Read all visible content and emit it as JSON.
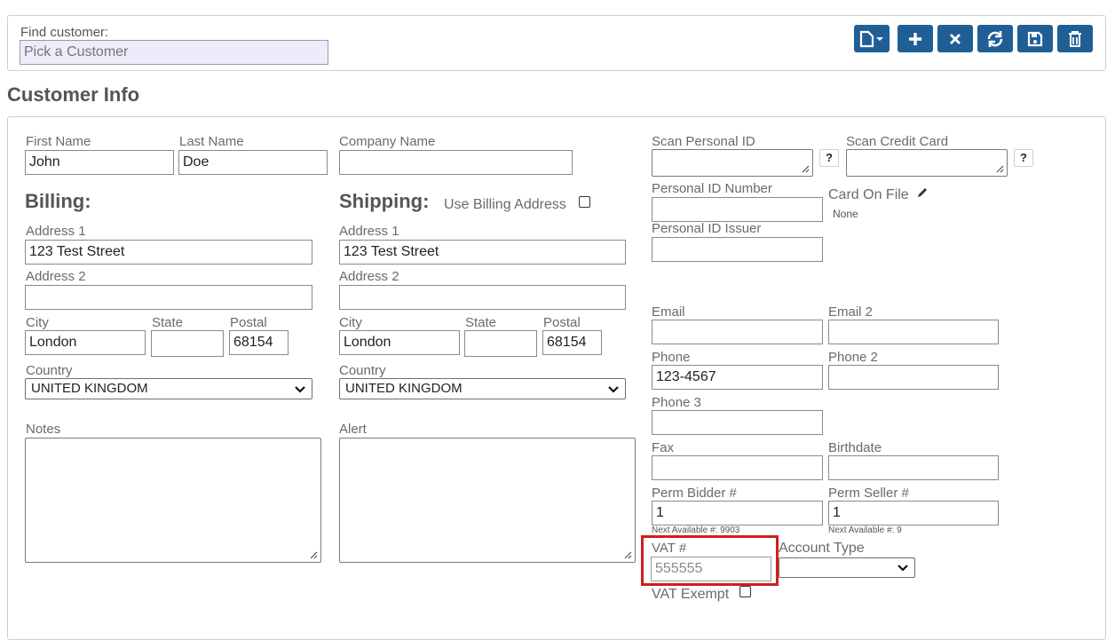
{
  "header": {
    "find_label": "Find customer:",
    "find_placeholder": "Pick a Customer"
  },
  "toolbar": {
    "buttons": [
      "new-document-menu",
      "add",
      "close",
      "refresh",
      "save",
      "delete"
    ]
  },
  "section_title": "Customer Info",
  "name": {
    "first_label": "First Name",
    "first_value": "John",
    "last_label": "Last Name",
    "last_value": "Doe",
    "company_label": "Company Name",
    "company_value": ""
  },
  "billing": {
    "heading": "Billing:",
    "address1_label": "Address 1",
    "address1_value": "123 Test Street",
    "address2_label": "Address 2",
    "address2_value": "",
    "city_label": "City",
    "city_value": "London",
    "state_label": "State",
    "state_value": "",
    "postal_label": "Postal",
    "postal_value": "68154",
    "country_label": "Country",
    "country_value": "UNITED KINGDOM"
  },
  "shipping": {
    "heading": "Shipping:",
    "use_billing_label": "Use Billing Address",
    "address1_label": "Address 1",
    "address1_value": "123 Test Street",
    "address2_label": "Address 2",
    "address2_value": "",
    "city_label": "City",
    "city_value": "London",
    "state_label": "State",
    "state_value": "",
    "postal_label": "Postal",
    "postal_value": "68154",
    "country_label": "Country",
    "country_value": "UNITED KINGDOM"
  },
  "notes_label": "Notes",
  "alert_label": "Alert",
  "scan": {
    "personal_id_label": "Scan Personal ID",
    "credit_card_label": "Scan Credit Card",
    "help_glyph": "?"
  },
  "personal_id_number_label": "Personal ID Number",
  "personal_id_issuer_label": "Personal ID Issuer",
  "card_on_file": {
    "label": "Card On File",
    "value": "None"
  },
  "contact": {
    "email_label": "Email",
    "email_value": "",
    "email2_label": "Email 2",
    "email2_value": "",
    "phone_label": "Phone",
    "phone_value": "123-4567",
    "phone2_label": "Phone 2",
    "phone2_value": "",
    "phone3_label": "Phone 3",
    "phone3_value": "",
    "fax_label": "Fax",
    "fax_value": "",
    "birthdate_label": "Birthdate",
    "birthdate_value": ""
  },
  "perm": {
    "bidder_label": "Perm Bidder #",
    "bidder_value": "1",
    "bidder_next": "Next Available #: 9903",
    "seller_label": "Perm Seller #",
    "seller_value": "1",
    "seller_next": "Next Available #: 9"
  },
  "vat": {
    "label": "VAT #",
    "value": "555555",
    "exempt_label": "VAT Exempt"
  },
  "account_type": {
    "label": "Account Type",
    "value": ""
  },
  "colors": {
    "toolbar_button": "#1f5f96",
    "highlight_box": "#d01e1e",
    "find_input_bg": "#ececfb"
  }
}
